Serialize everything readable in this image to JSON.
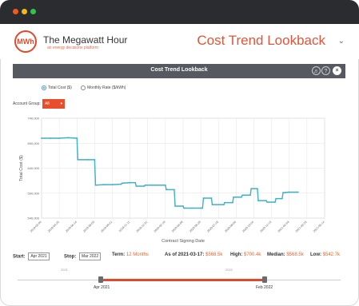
{
  "window": {
    "title_dots": [
      "close",
      "minimize",
      "maximize"
    ]
  },
  "header": {
    "logo_text": "MWh",
    "brand": "The Megawatt Hour",
    "tagline": "an energy decisions platform",
    "page_title": "Cost Trend Lookback",
    "chevron_icon": "chevron-down-icon"
  },
  "panel": {
    "title": "Cost Trend Lookback",
    "icons": [
      "bell-icon",
      "help-icon",
      "close-icon"
    ],
    "radio_total": "Total Cost ($)",
    "radio_monthly": "Monthly Rate ($/kWh)",
    "account_label": "Account Group:",
    "account_value": "All"
  },
  "controls": {
    "start_label": "Start:",
    "start_value": "Apr 2021",
    "stop_label": "Stop:",
    "stop_value": "Mar 2022",
    "term_label": "Term:",
    "term_value": "12 Months",
    "asof_label": "As of 2021-03-17:",
    "asof_value": "$568.5k",
    "high_label": "High:",
    "high_value": "$700.4k",
    "median_label": "Median:",
    "median_value": "$568.5k",
    "low_label": "Low:",
    "low_value": "$542.7k"
  },
  "slider": {
    "year_left": "2021",
    "year_right": "2022",
    "start_handle_label": "Apr 2021",
    "stop_handle_label": "Feb 2022",
    "start_fraction": 0.25,
    "stop_fraction": 0.76
  },
  "colors": {
    "accent": "#e0553a",
    "line": "#3db1c5",
    "panelbar": "#565a60"
  },
  "chart_data": {
    "type": "line",
    "xlabel": "Contract Signing Date",
    "ylabel": "Total Cost ($)",
    "ylim": [
      540000,
      740000
    ],
    "yticks": [
      540000,
      590000,
      640000,
      690000,
      740000
    ],
    "ytick_labels": [
      "540,000",
      "590,000",
      "640,000",
      "690,000",
      "740,000"
    ],
    "xtick_labels": [
      "2019-03-06",
      "2019-04-25",
      "2019-06-14",
      "2019-08-03",
      "2019-09-22",
      "2019-11-11",
      "2019-12-31",
      "2020-02-19",
      "2020-04-09",
      "2020-05-29",
      "2020-07-18",
      "2020-09-06",
      "2020-10-26",
      "2020-12-15",
      "2021-02-03",
      "2021-03-25",
      "2021-05-14"
    ],
    "grid": true,
    "series": [
      {
        "values": [
          [
            0.0,
            700
          ],
          [
            0.5,
            700
          ],
          [
            1.0,
            700
          ],
          [
            1.5,
            701
          ],
          [
            2.0,
            700
          ],
          [
            2.05,
            657
          ],
          [
            2.6,
            657
          ],
          [
            3.0,
            657
          ],
          [
            3.05,
            606
          ],
          [
            3.5,
            607
          ],
          [
            4.0,
            607
          ],
          [
            4.5,
            608
          ],
          [
            4.55,
            610
          ],
          [
            5.0,
            611
          ],
          [
            5.3,
            611
          ],
          [
            5.35,
            604
          ],
          [
            5.8,
            604
          ],
          [
            5.85,
            606
          ],
          [
            6.5,
            606
          ],
          [
            7.0,
            606
          ],
          [
            7.05,
            597
          ],
          [
            7.5,
            597
          ],
          [
            7.55,
            564
          ],
          [
            8.0,
            564
          ],
          [
            8.05,
            560
          ],
          [
            8.5,
            560
          ],
          [
            9.0,
            560
          ],
          [
            9.1,
            560
          ],
          [
            9.15,
            580
          ],
          [
            9.6,
            580
          ],
          [
            9.65,
            567
          ],
          [
            10.3,
            567
          ],
          [
            10.35,
            571
          ],
          [
            10.8,
            571
          ],
          [
            10.85,
            582
          ],
          [
            11.3,
            582
          ],
          [
            11.35,
            586
          ],
          [
            11.8,
            586
          ],
          [
            11.85,
            599
          ],
          [
            12.2,
            599
          ],
          [
            12.25,
            575
          ],
          [
            12.7,
            575
          ],
          [
            12.75,
            572
          ],
          [
            13.2,
            572
          ],
          [
            13.25,
            579
          ],
          [
            13.6,
            579
          ],
          [
            13.65,
            591
          ],
          [
            14.0,
            592
          ],
          [
            14.5,
            592
          ]
        ]
      }
    ]
  }
}
